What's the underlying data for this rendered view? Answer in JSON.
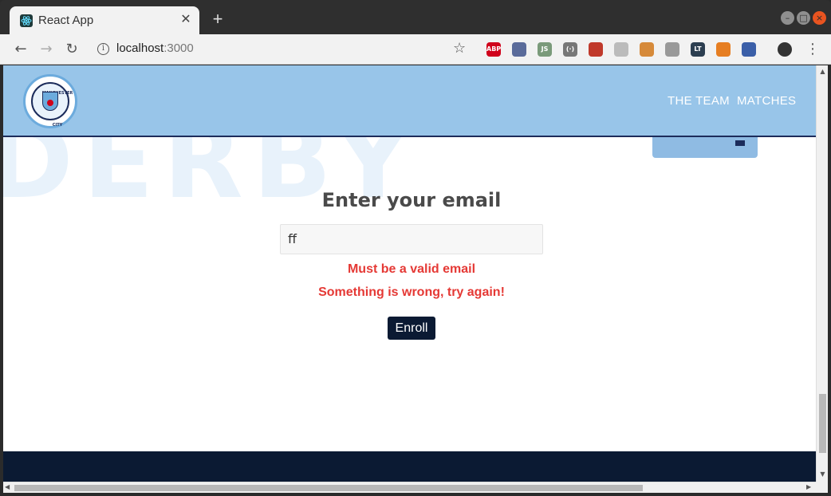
{
  "browser": {
    "tab_title": "React App",
    "tab_close": "✕",
    "new_tab": "+",
    "url_host": "localhost",
    "url_port": ":3000"
  },
  "extensions": [
    {
      "name": "abp-extension-icon",
      "label": "ABP",
      "color": "#d0021b"
    },
    {
      "name": "color-extension-icon",
      "label": "",
      "color": "#5a6b9a"
    },
    {
      "name": "js-extension-icon",
      "label": "JS",
      "color": "#7a9a7a"
    },
    {
      "name": "code-extension-icon",
      "label": "(·)",
      "color": "#777777"
    },
    {
      "name": "puzzle-extension-icon",
      "label": "",
      "color": "#c0392b"
    },
    {
      "name": "timer-extension-icon",
      "label": "",
      "color": "#bbbbbb"
    },
    {
      "name": "cookie-extension-icon",
      "label": "",
      "color": "#d68a3a"
    },
    {
      "name": "link-extension-icon",
      "label": "",
      "color": "#999999"
    },
    {
      "name": "lt-extension-icon",
      "label": "LT",
      "color": "#2c3e50"
    },
    {
      "name": "tiger-extension-icon",
      "label": "",
      "color": "#e67e22"
    },
    {
      "name": "save-extension-icon",
      "label": "",
      "color": "#3b5fa8"
    },
    {
      "name": "profile-avatar-icon",
      "label": "",
      "color": "#333333"
    }
  ],
  "site": {
    "crest_top": "MANCHESTER",
    "crest_bottom": "CITY",
    "nav": [
      "THE TEAM",
      "MATCHES"
    ],
    "background_word": "DERBY"
  },
  "form": {
    "title": "Enter your email",
    "email_value": "ff",
    "error_invalid": "Must be a valid email",
    "error_generic": "Something is wrong, try again!",
    "submit_label": "Enroll"
  },
  "colors": {
    "header": "#98c5e9",
    "navy": "#0b1a33",
    "error": "#e53935"
  }
}
